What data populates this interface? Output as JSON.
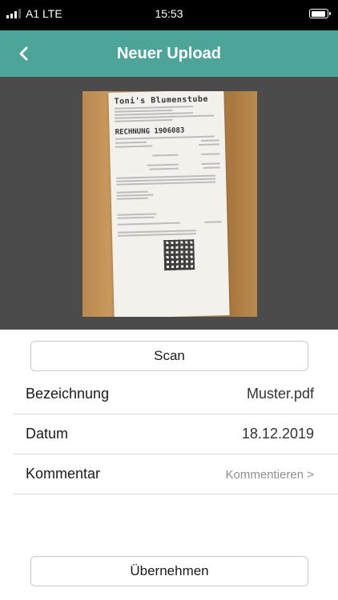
{
  "status_bar": {
    "carrier": "A1 LTE",
    "time": "15:53",
    "battery_icon": "battery-full-icon"
  },
  "nav": {
    "title": "Neuer Upload",
    "back_icon": "chevron-left-icon",
    "bar_color": "#4da59a"
  },
  "preview": {
    "receipt_title": "Toni's Blumenstube",
    "receipt_number_label": "RECHNUNG  1906083"
  },
  "scan_button": {
    "label": "Scan"
  },
  "fields": [
    {
      "label": "Bezeichnung",
      "value": "Muster.pdf"
    },
    {
      "label": "Datum",
      "value": "18.12.2019"
    },
    {
      "label": "Kommentar",
      "value": "Kommentieren >"
    }
  ],
  "accept_button": {
    "label": "Übernehmen"
  }
}
